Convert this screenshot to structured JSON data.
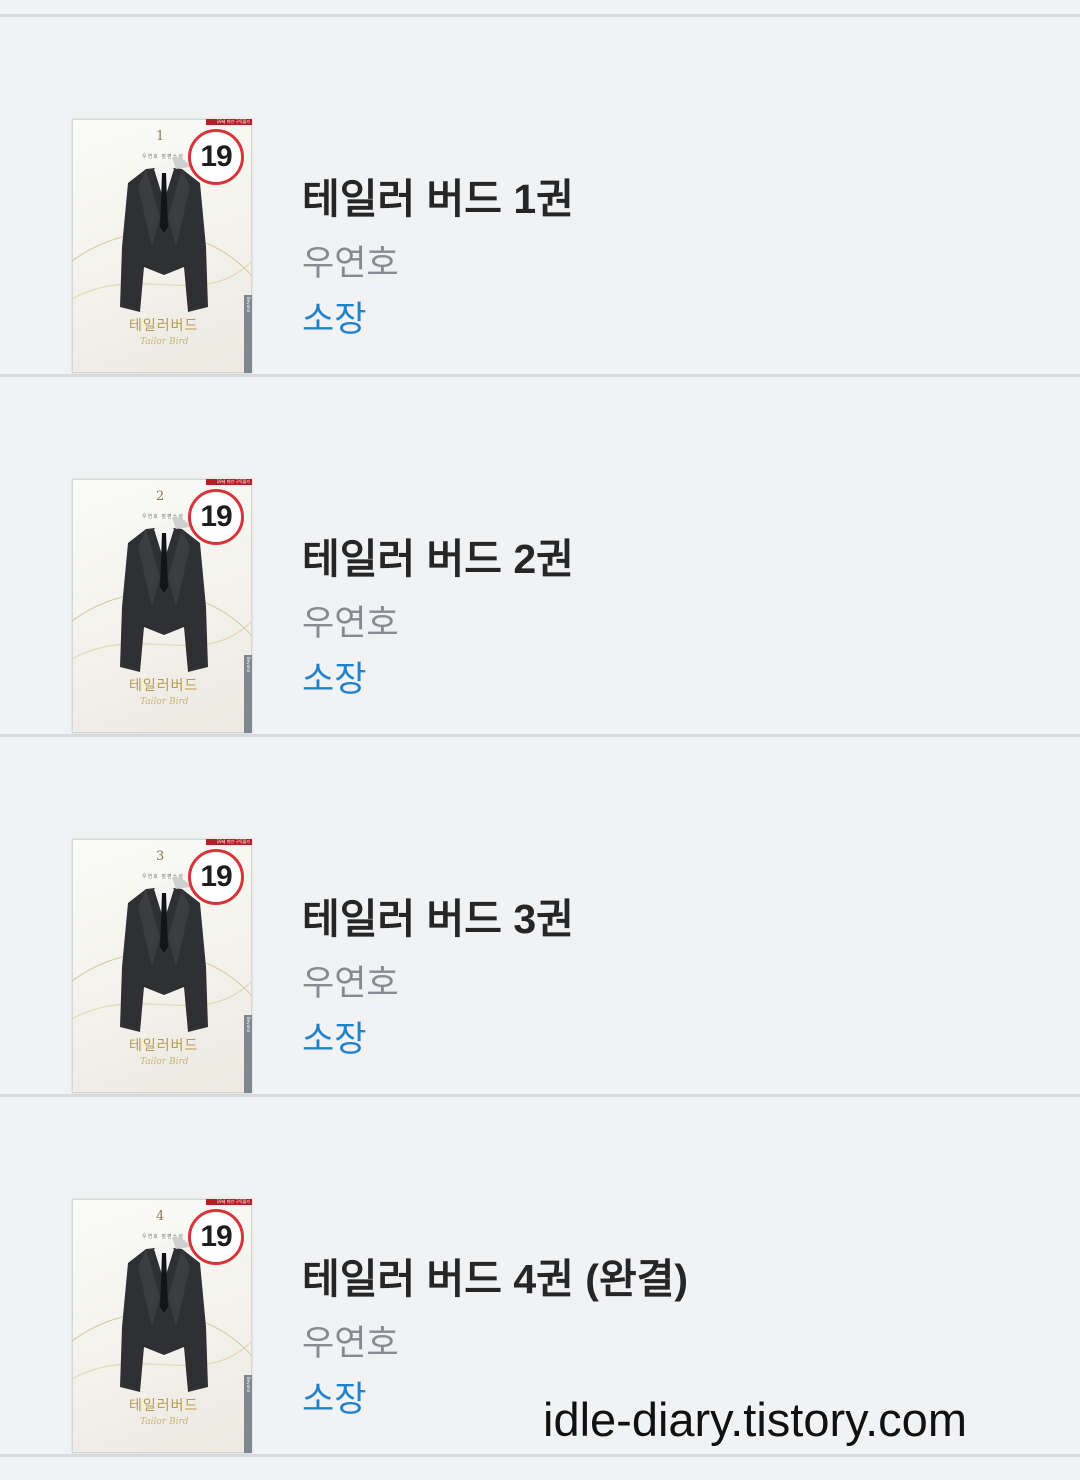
{
  "books": [
    {
      "title": "테일러 버드 1권",
      "author": "우연호",
      "status": "소장",
      "rating_badge": "19",
      "cover": {
        "volume": "1",
        "title": "테일러버드",
        "subtitle": "Tailor Bird",
        "author": "우연호 장편소설",
        "age_notice": "19세 미만 구독불가",
        "publisher": "Beyond"
      }
    },
    {
      "title": "테일러 버드 2권",
      "author": "우연호",
      "status": "소장",
      "rating_badge": "19",
      "cover": {
        "volume": "2",
        "title": "테일러버드",
        "subtitle": "Tailor Bird",
        "author": "우연호 장편소설",
        "age_notice": "19세 미만 구독불가",
        "publisher": "Beyond"
      }
    },
    {
      "title": "테일러 버드 3권",
      "author": "우연호",
      "status": "소장",
      "rating_badge": "19",
      "cover": {
        "volume": "3",
        "title": "테일러버드",
        "subtitle": "Tailor Bird",
        "author": "우연호 장편소설",
        "age_notice": "19세 미만 구독불가",
        "publisher": "Beyond"
      }
    },
    {
      "title": "테일러 버드 4권 (완결)",
      "author": "우연호",
      "status": "소장",
      "rating_badge": "19",
      "cover": {
        "volume": "4",
        "title": "테일러버드",
        "subtitle": "Tailor Bird",
        "author": "우연호 장편소설",
        "age_notice": "19세 미만 구독불가",
        "publisher": "Beyond"
      }
    }
  ],
  "watermark": "idle-diary.tistory.com",
  "colors": {
    "background": "#f1f2f4",
    "divider": "#d9dbde",
    "title": "#262626",
    "author": "#858b91",
    "status": "#1f82cf",
    "badge_ring": "#d8353a"
  }
}
